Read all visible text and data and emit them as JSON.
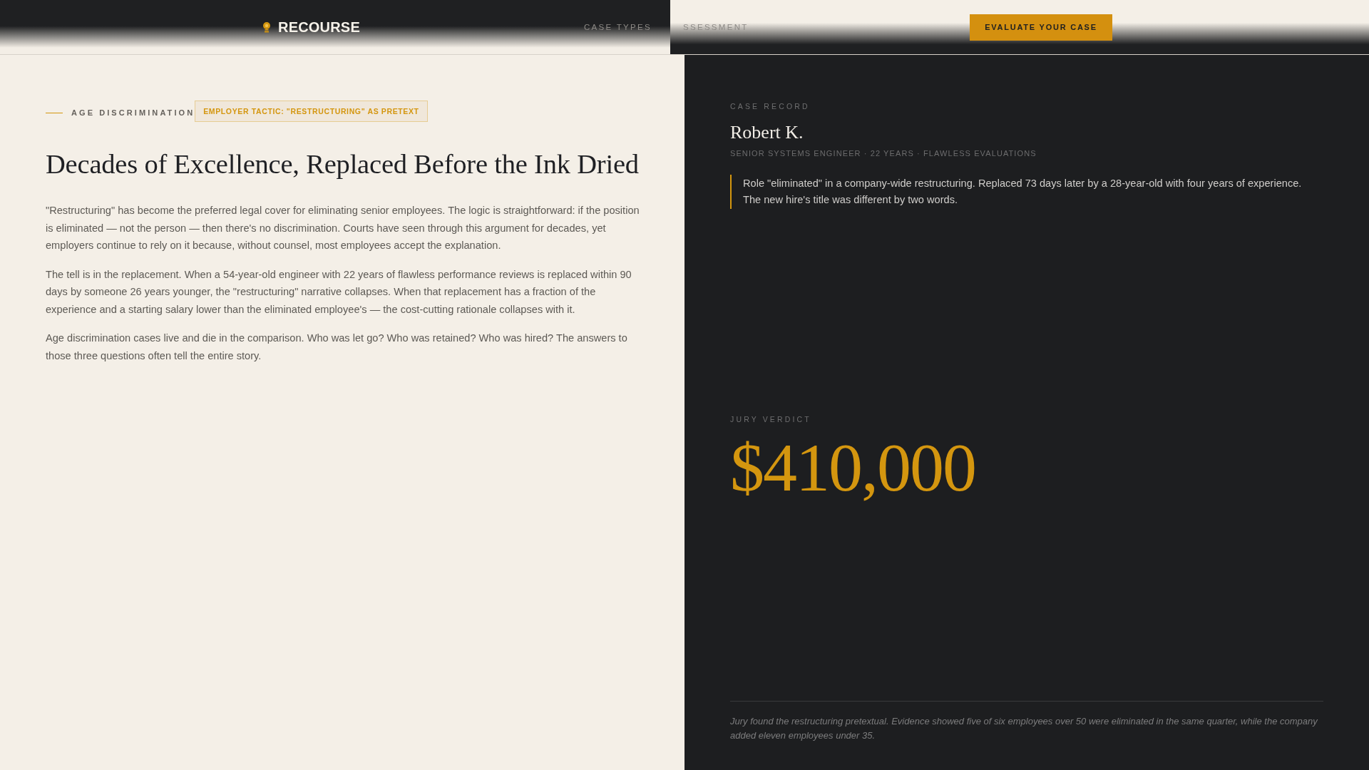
{
  "header": {
    "logo": "RECOURSE",
    "nav": [
      {
        "label": "CASE TYPES"
      },
      {
        "label": "SSESSMENT"
      }
    ],
    "cta": "EVALUATE YOUR CASE"
  },
  "article": {
    "category": "AGE DISCRIMINATION",
    "tag": "EMPLOYER TACTIC: \"RESTRUCTURING\" AS PRETEXT",
    "title": "Decades of Excellence, Replaced Before the Ink Dried",
    "paragraphs": [
      "\"Restructuring\" has become the preferred legal cover for eliminating senior employees. The logic is straightforward: if the position is eliminated — not the person — then there's no discrimination. Courts have seen through this argument for decades, yet employers continue to rely on it because, without counsel, most employees accept the explanation.",
      "The tell is in the replacement. When a 54-year-old engineer with 22 years of flawless performance reviews is replaced within 90 days by someone 26 years younger, the \"restructuring\" narrative collapses. When that replacement has a fraction of the experience and a starting salary lower than the eliminated employee's — the cost-cutting rationale collapses with it.",
      "Age discrimination cases live and die in the comparison. Who was let go? Who was retained? Who was hired? The answers to those three questions often tell the entire story."
    ]
  },
  "case_record": {
    "label": "CASE RECORD",
    "name": "Robert K.",
    "details": "SENIOR SYSTEMS ENGINEER · 22 YEARS · FLAWLESS EVALUATIONS",
    "summary": "Role \"eliminated\" in a company-wide restructuring. Replaced 73 days later by a 28-year-old with four years of experience. The new hire's title was different by two words."
  },
  "verdict": {
    "label": "JURY VERDICT",
    "amount": "$410,000",
    "note": "Jury found the restructuring pretextual. Evidence showed five of six employees over 50 were eliminated in the same quarter, while the company added eleven employees under 35."
  }
}
